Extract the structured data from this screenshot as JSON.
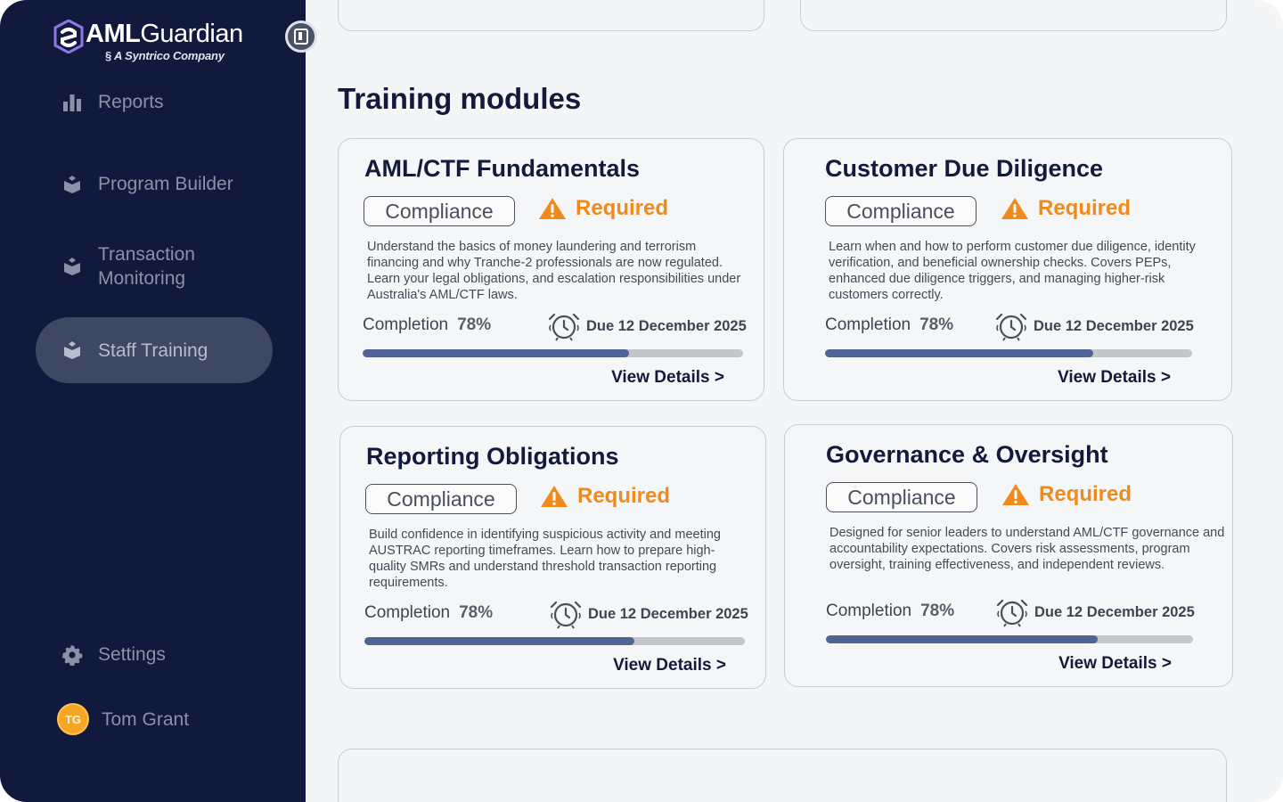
{
  "brand": {
    "name_bold": "AML",
    "name_regular": "Guardian",
    "subtitle": "A Syntrico Company"
  },
  "sidebar": {
    "items": [
      {
        "label": "Reports",
        "icon": "bar-chart-icon"
      },
      {
        "label": "Program Builder",
        "icon": "box-icon"
      },
      {
        "label": "Transaction Monitoring",
        "icon": "box-icon"
      },
      {
        "label": "Staff Training",
        "icon": "box-icon",
        "active": true
      }
    ],
    "settings": {
      "label": "Settings",
      "icon": "gear-icon"
    },
    "user": {
      "initials": "TG",
      "name": "Tom Grant"
    }
  },
  "section": {
    "title": "Training modules"
  },
  "modules": [
    {
      "title": "AML/CTF Fundamentals",
      "tag": "Compliance",
      "status": "Required",
      "description": "Understand the basics of money laundering and terrorism financing and why Tranche-2 professionals are now regulated. Learn your legal obligations, and escalation responsibilities under Australia's AML/CTF laws.",
      "completion_label": "Completion",
      "completion": "78%",
      "progress": 0.7,
      "due": "Due 12 December 2025",
      "link": "View Details >"
    },
    {
      "title": "Customer Due Diligence",
      "tag": "Compliance",
      "status": "Required",
      "description": "Learn when and how to perform customer due diligence, identity verification, and beneficial ownership checks. Covers PEPs, enhanced due diligence triggers, and managing higher-risk customers correctly.",
      "completion_label": "Completion",
      "completion": "78%",
      "progress": 0.73,
      "due": "Due 12 December 2025",
      "link": "View Details >"
    },
    {
      "title": "Reporting Obligations",
      "tag": "Compliance",
      "status": "Required",
      "description": "Build confidence in identifying suspicious activity and meeting AUSTRAC reporting timeframes. Learn how to prepare high-quality SMRs and understand threshold transaction reporting requirements.",
      "completion_label": "Completion",
      "completion": "78%",
      "progress": 0.71,
      "due": "Due 12 December 2025",
      "link": "View Details >"
    },
    {
      "title": "Governance & Oversight",
      "tag": "Compliance",
      "status": "Required",
      "description": "Designed for senior leaders to understand AML/CTF governance and accountability expectations. Covers risk assessments, program oversight, training effectiveness, and independent reviews.",
      "completion_label": "Completion",
      "completion": "78%",
      "progress": 0.74,
      "due": "Due 12 December 2025",
      "link": "View Details >"
    }
  ],
  "colors": {
    "sidebar_bg": "#111a3c",
    "active_item_bg": "#3e4764",
    "required": "#f08a1c",
    "progress_fill": "#4f6394",
    "progress_track": "#c4c6cc"
  }
}
